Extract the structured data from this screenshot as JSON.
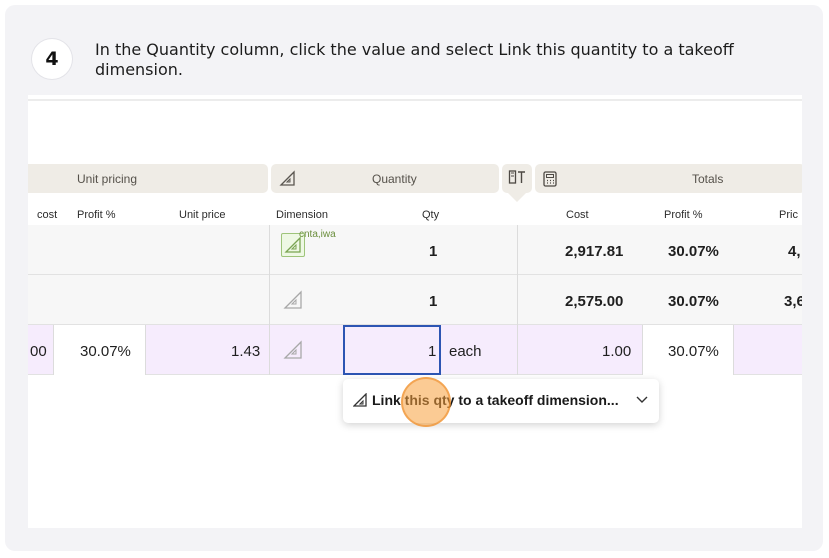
{
  "step": {
    "number": "4",
    "instruction": "In the Quantity column, click the value and select Link this quantity to a takeoff dimension."
  },
  "groups": {
    "unit_pricing": "Unit pricing",
    "quantity": "Quantity",
    "totals": "Totals"
  },
  "columns": {
    "cost_left": "cost",
    "profit_pct": "Profit %",
    "unit_price": "Unit price",
    "dimension": "Dimension",
    "qty": "Qty",
    "cost": "Cost",
    "profit_pct_right": "Profit %",
    "price": "Pric"
  },
  "rows": [
    {
      "dimension_tag": "cnta,iwa",
      "qty": "1",
      "cost": "2,917.81",
      "profit": "30.07%",
      "price": "4,"
    },
    {
      "qty": "1",
      "cost": "2,575.00",
      "profit": "30.07%",
      "price": "3,6"
    },
    {
      "cost_left": "00",
      "profit_left": "30.07%",
      "unit_price": "1.43",
      "qty": "1",
      "unit": "each",
      "cost": "1.00",
      "profit": "30.07%"
    }
  ],
  "menu": {
    "label": "Link this qty to a takeoff dimension..."
  },
  "colors": {
    "selection_border": "#2d55b3",
    "selected_row": "#f6ecfd",
    "click_indicator": "#f7a03c"
  }
}
